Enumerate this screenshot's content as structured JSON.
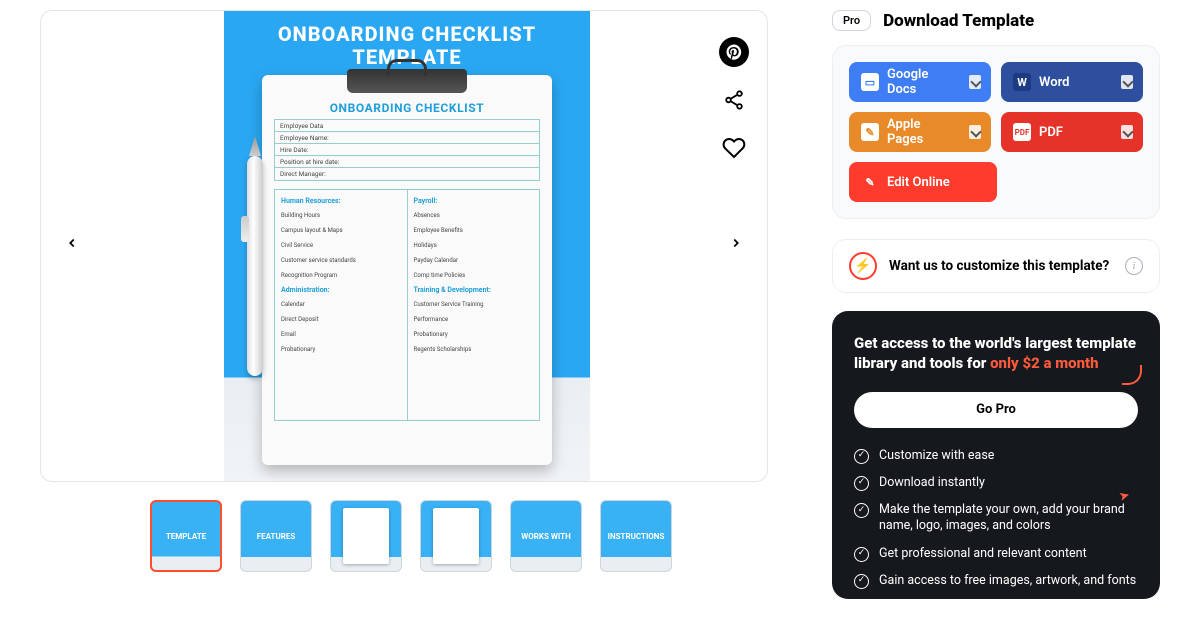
{
  "badge": "Pro",
  "title": "Download Template",
  "downloads": {
    "google": "Google Docs",
    "word": "Word",
    "apple": "Apple Pages",
    "pdf": "PDF",
    "edit": "Edit Online"
  },
  "customize": "Want us to customize this template?",
  "pro": {
    "lead": "Get access to the world's largest template library and tools for ",
    "price": "only $2 a month",
    "cta": "Go Pro",
    "features": [
      "Customize with ease",
      "Download instantly",
      "Make the template your own, add your brand name, logo, images, and colors",
      "Get professional and relevant content",
      "Gain access to free images, artwork, and fonts"
    ]
  },
  "slide": {
    "headline1": "ONBOARDING CHECKLIST",
    "headline2": "TEMPLATE",
    "doc_title": "ONBOARDING CHECKLIST",
    "fields": [
      "Employee Data",
      "Employee Name:",
      "Hire Date:",
      "Position at hire date:",
      "Direct Manager:"
    ],
    "left_sections": [
      {
        "h": "Human Resources:",
        "items": [
          "Building Hours",
          "Campus layout & Maps",
          "Civil Service",
          "Customer service standards",
          "Recognition Program"
        ]
      },
      {
        "h": "Administration:",
        "items": [
          "Calendar",
          "Direct Deposit",
          "Email",
          "Probationary"
        ]
      }
    ],
    "right_sections": [
      {
        "h": "Payroll:",
        "items": [
          "Absences",
          "Employee Benefits",
          "Holidays",
          "Payday Calendar",
          "Comp time Policies"
        ]
      },
      {
        "h": "Training & Development:",
        "items": [
          "Customer Service Training",
          "Performance",
          "Probationary",
          "Regents Scholarships"
        ]
      }
    ]
  },
  "thumbs": [
    "TEMPLATE",
    "FEATURES",
    "",
    "",
    "WORKS WITH",
    "INSTRUCTIONS"
  ]
}
